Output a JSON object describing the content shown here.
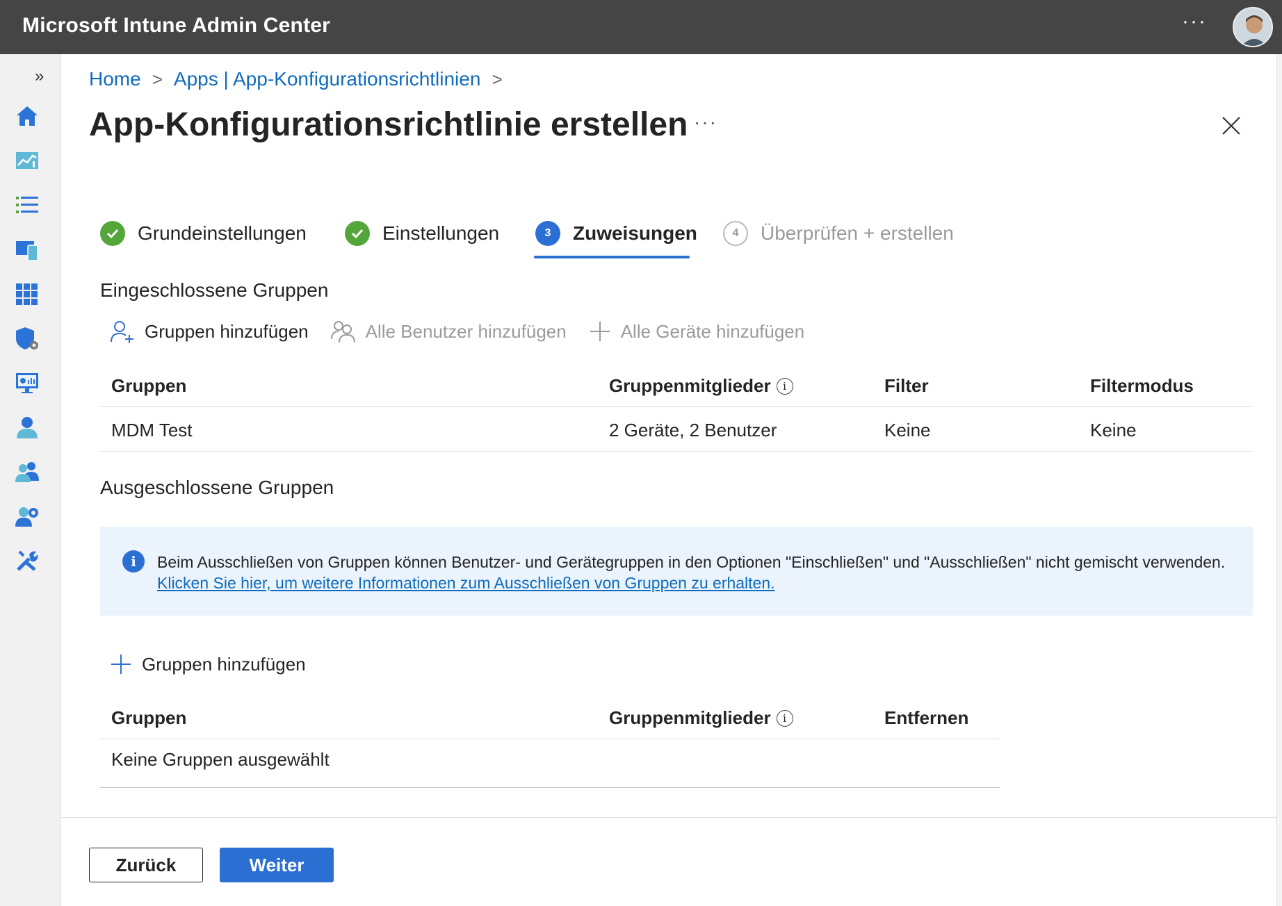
{
  "app": {
    "title": "Microsoft Intune Admin Center",
    "more": "···"
  },
  "sidebar": {
    "collapse": "»",
    "items": [
      "home-icon",
      "dashboard-icon",
      "all-services-icon",
      "devices-icon",
      "apps-icon",
      "endpoint-security-icon",
      "reports-icon",
      "users-icon",
      "groups-icon",
      "tenant-admin-icon",
      "troubleshooting-icon"
    ]
  },
  "breadcrumb": {
    "home": "Home",
    "apps": "Apps | App-Konfigurationsrichtlinien"
  },
  "page": {
    "title": "App-Konfigurationsrichtlinie erstellen",
    "more": "···"
  },
  "steps": [
    {
      "label": "Grundeinstellungen",
      "state": "done"
    },
    {
      "label": "Einstellungen",
      "state": "done"
    },
    {
      "number": "3",
      "label": "Zuweisungen",
      "state": "active"
    },
    {
      "number": "4",
      "label": "Überprüfen + erstellen",
      "state": "pending"
    }
  ],
  "included": {
    "heading": "Eingeschlossene Gruppen",
    "actions": {
      "add_groups": "Gruppen hinzufügen",
      "add_all_users": "Alle Benutzer hinzufügen",
      "add_all_devices": "Alle Geräte hinzufügen"
    },
    "columns": {
      "groups": "Gruppen",
      "members": "Gruppenmitglieder",
      "filter": "Filter",
      "filter_mode": "Filtermodus"
    },
    "rows": [
      {
        "group": "MDM Test",
        "members": "2 Geräte, 2 Benutzer",
        "filter": "Keine",
        "filter_mode": "Keine"
      }
    ]
  },
  "excluded": {
    "heading": "Ausgeschlossene Gruppen",
    "info_text": "Beim Ausschließen von Gruppen können Benutzer- und Gerätegruppen in den Optionen \"Einschließen\" und \"Ausschließen\" nicht gemischt verwenden. ",
    "info_link": "Klicken Sie hier, um weitere Informationen zum Ausschließen von Gruppen zu erhalten.",
    "add_groups": "Gruppen hinzufügen",
    "columns": {
      "groups": "Gruppen",
      "members": "Gruppenmitglieder",
      "remove": "Entfernen"
    },
    "empty": "Keine Gruppen ausgewählt"
  },
  "footer": {
    "back": "Zurück",
    "next": "Weiter"
  },
  "colors": {
    "accent": "#2b6fd3",
    "success": "#54a53a",
    "topbar": "#454545",
    "link": "#0f6cbd"
  }
}
